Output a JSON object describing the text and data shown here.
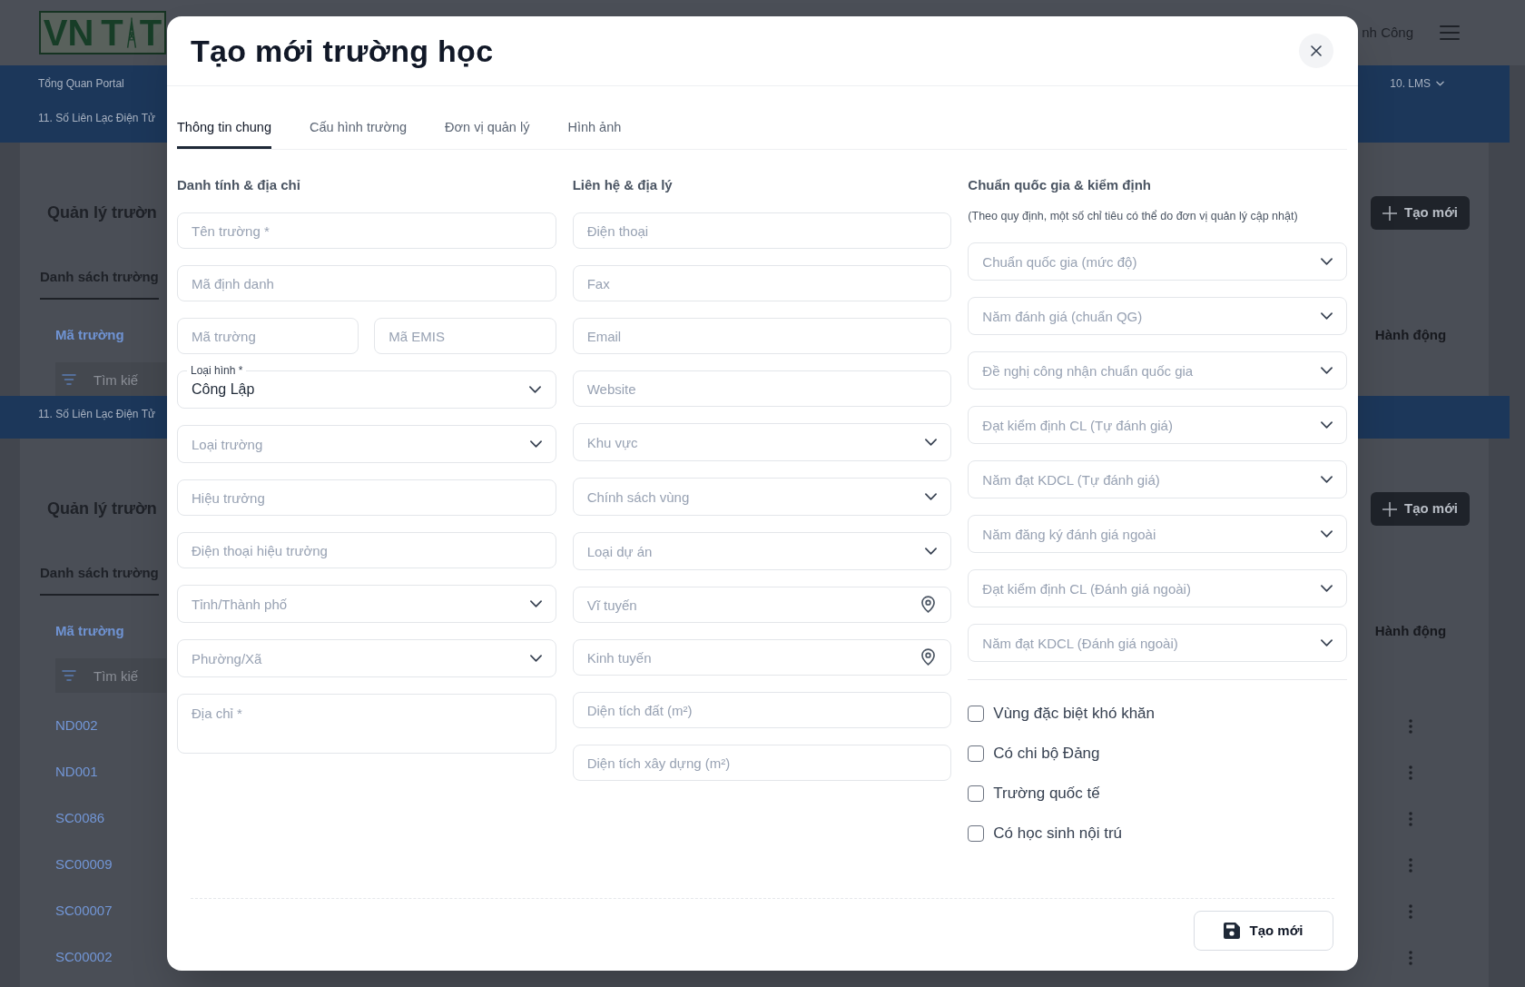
{
  "background": {
    "header": {
      "logo": [
        "VN",
        "T",
        "T"
      ],
      "user_name": "nh Công"
    },
    "blocks": [
      {
        "kind": "nav_band",
        "items": [
          "Tổng Quan Portal",
          "11. Số Liên Lạc Điện Tử"
        ],
        "right_item": "10. LMS"
      },
      {
        "kind": "section",
        "title": "Quản lý trườn",
        "create_button": "Tạo mới",
        "tab": {
          "label": "Danh sách trường",
          "selected": true
        },
        "columns": [
          "Mã trường",
          "Hành động"
        ],
        "filter_placeholder": "Tìm kiế"
      },
      {
        "kind": "nav_band",
        "items": [
          "11. Số Liên Lạc Điện Tử"
        ]
      },
      {
        "kind": "section",
        "title": "Quản lý trườn",
        "create_button": "Tạo mới",
        "tab": {
          "label": "Danh sách trường",
          "selected": true
        },
        "columns": [
          "Mã trường",
          "Hành động"
        ],
        "filter_placeholder": "Tìm kiế",
        "rows": [
          {
            "code": "ND002"
          },
          {
            "code": "ND001"
          },
          {
            "code": "SC0086"
          },
          {
            "code": "SC00009"
          },
          {
            "code": "SC00007"
          },
          {
            "code": "SC00002"
          }
        ]
      }
    ]
  },
  "dialog": {
    "title": "Tạo mới trường học",
    "tabs": [
      {
        "label": "Thông tin chung",
        "selected": true
      },
      {
        "label": "Cấu hình trường",
        "selected": false
      },
      {
        "label": "Đơn vị quản lý",
        "selected": false
      },
      {
        "label": "Hình ảnh",
        "selected": false
      }
    ],
    "columns": [
      {
        "heading": "Danh tính & địa chỉ",
        "fields": [
          {
            "kind": "text",
            "placeholder": "Tên trường *"
          },
          {
            "kind": "text",
            "placeholder": "Mã định danh"
          },
          {
            "kind": "pair",
            "fields": [
              {
                "kind": "text",
                "placeholder": "Mã trường"
              },
              {
                "kind": "text",
                "placeholder": "Mã EMIS"
              }
            ]
          },
          {
            "kind": "select",
            "label": "Loại hình *",
            "value": "Công Lập"
          },
          {
            "kind": "select",
            "placeholder": "Loại trường"
          },
          {
            "kind": "text",
            "placeholder": "Hiệu trưởng"
          },
          {
            "kind": "text",
            "placeholder": "Điện thoại hiệu trưởng"
          },
          {
            "kind": "select",
            "placeholder": "Tỉnh/Thành phố"
          },
          {
            "kind": "select",
            "placeholder": "Phường/Xã"
          },
          {
            "kind": "textarea",
            "placeholder": "Địa chỉ *"
          }
        ]
      },
      {
        "heading": "Liên hệ & địa lý",
        "fields": [
          {
            "kind": "text",
            "placeholder": "Điện thoại"
          },
          {
            "kind": "text",
            "placeholder": "Fax"
          },
          {
            "kind": "text",
            "placeholder": "Email"
          },
          {
            "kind": "text",
            "placeholder": "Website"
          },
          {
            "kind": "select",
            "placeholder": "Khu vực"
          },
          {
            "kind": "select",
            "placeholder": "Chính sách vùng"
          },
          {
            "kind": "select",
            "placeholder": "Loại dự án"
          },
          {
            "kind": "location",
            "placeholder": "Vĩ tuyến"
          },
          {
            "kind": "location",
            "placeholder": "Kinh tuyến"
          },
          {
            "kind": "text",
            "placeholder": "Diện tích đất (m²)"
          },
          {
            "kind": "text",
            "placeholder": "Diện tích xây dựng (m²)"
          }
        ]
      },
      {
        "heading": "Chuẩn quốc gia & kiểm định",
        "note": "(Theo quy định, một số chỉ tiêu có thể do đơn vị quản lý cập nhật)",
        "fields": [
          {
            "kind": "select",
            "placeholder": "Chuẩn quốc gia (mức độ)"
          },
          {
            "kind": "select",
            "placeholder": "Năm đánh giá (chuẩn QG)"
          },
          {
            "kind": "select",
            "placeholder": "Đề nghị công nhận chuẩn quốc gia"
          },
          {
            "kind": "select",
            "placeholder": "Đạt kiểm định CL (Tự đánh giá)"
          },
          {
            "kind": "select",
            "placeholder": "Năm đạt KDCL (Tự đánh giá)"
          },
          {
            "kind": "select",
            "placeholder": "Năm đăng ký đánh giá ngoài"
          },
          {
            "kind": "select",
            "placeholder": "Đạt kiểm định CL (Đánh giá ngoài)"
          },
          {
            "kind": "select",
            "placeholder": "Năm đạt KDCL (Đánh giá ngoài)"
          }
        ],
        "checkboxes": [
          {
            "label": "Vùng đặc biệt khó khăn",
            "checked": false
          },
          {
            "label": "Có chi bộ Đảng",
            "checked": false
          },
          {
            "label": "Trường quốc tế",
            "checked": false
          },
          {
            "label": "Có học sinh nội trú",
            "checked": false
          }
        ]
      }
    ],
    "submit_button": "Tạo mới"
  }
}
